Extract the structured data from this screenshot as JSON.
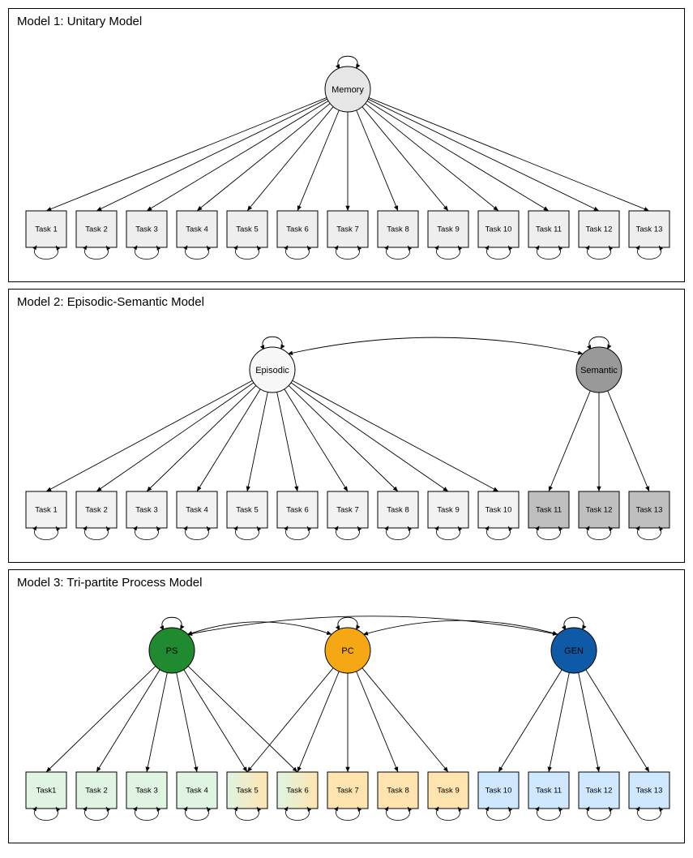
{
  "chart_data": [
    {
      "type": "graph-structure",
      "title": "Model 1: Unitary Model",
      "factors": [
        {
          "name": "Memory",
          "color": "#e6e6e6",
          "tasks": [
            1,
            2,
            3,
            4,
            5,
            6,
            7,
            8,
            9,
            10,
            11,
            12,
            13
          ],
          "self_loop": true
        }
      ],
      "between_factor_paths": [],
      "tasks": [
        {
          "label": "Task 1",
          "fill": "#eeeeee"
        },
        {
          "label": "Task 2",
          "fill": "#eeeeee"
        },
        {
          "label": "Task 3",
          "fill": "#eeeeee"
        },
        {
          "label": "Task 4",
          "fill": "#eeeeee"
        },
        {
          "label": "Task 5",
          "fill": "#eeeeee"
        },
        {
          "label": "Task 6",
          "fill": "#eeeeee"
        },
        {
          "label": "Task 7",
          "fill": "#eeeeee"
        },
        {
          "label": "Task 8",
          "fill": "#eeeeee"
        },
        {
          "label": "Task 9",
          "fill": "#eeeeee"
        },
        {
          "label": "Task 10",
          "fill": "#eeeeee"
        },
        {
          "label": "Task 11",
          "fill": "#eeeeee"
        },
        {
          "label": "Task 12",
          "fill": "#eeeeee"
        },
        {
          "label": "Task 13",
          "fill": "#eeeeee"
        }
      ],
      "task_error_loops": true
    },
    {
      "type": "graph-structure",
      "title": "Model 2: Episodic-Semantic Model",
      "factors": [
        {
          "name": "Episodic",
          "color": "#f7f7f7",
          "tasks": [
            1,
            2,
            3,
            4,
            5,
            6,
            7,
            8,
            9,
            10
          ],
          "self_loop": true
        },
        {
          "name": "Semantic",
          "color": "#999999",
          "tasks": [
            11,
            12,
            13
          ],
          "self_loop": true
        }
      ],
      "between_factor_paths": [
        [
          "Episodic",
          "Semantic"
        ]
      ],
      "tasks": [
        {
          "label": "Task 1",
          "fill": "#f2f2f2"
        },
        {
          "label": "Task 2",
          "fill": "#f2f2f2"
        },
        {
          "label": "Task 3",
          "fill": "#f2f2f2"
        },
        {
          "label": "Task 4",
          "fill": "#f2f2f2"
        },
        {
          "label": "Task 5",
          "fill": "#f2f2f2"
        },
        {
          "label": "Task 6",
          "fill": "#f2f2f2"
        },
        {
          "label": "Task 7",
          "fill": "#f2f2f2"
        },
        {
          "label": "Task 8",
          "fill": "#f2f2f2"
        },
        {
          "label": "Task 9",
          "fill": "#f2f2f2"
        },
        {
          "label": "Task 10",
          "fill": "#f2f2f2"
        },
        {
          "label": "Task 11",
          "fill": "#bfbfbf"
        },
        {
          "label": "Task 12",
          "fill": "#bfbfbf"
        },
        {
          "label": "Task 13",
          "fill": "#bfbfbf"
        }
      ],
      "task_error_loops": true
    },
    {
      "type": "graph-structure",
      "title": "Model 3: Tri-partite Process Model",
      "factors": [
        {
          "name": "PS",
          "color": "#1f8a2f",
          "tasks": [
            1,
            2,
            3,
            4,
            5,
            6
          ],
          "self_loop": true
        },
        {
          "name": "PC",
          "color": "#f5a814",
          "tasks": [
            5,
            6,
            7,
            8,
            9
          ],
          "self_loop": true
        },
        {
          "name": "GEN",
          "color": "#0f5aa6",
          "tasks": [
            10,
            11,
            12,
            13
          ],
          "self_loop": true
        }
      ],
      "between_factor_paths": [
        [
          "PS",
          "PC"
        ],
        [
          "PC",
          "GEN"
        ],
        [
          "PS",
          "GEN"
        ]
      ],
      "tasks": [
        {
          "label": "Task1",
          "fill": "#dff4e1"
        },
        {
          "label": "Task 2",
          "fill": "#dff4e1"
        },
        {
          "label": "Task 3",
          "fill": "#dff4e1"
        },
        {
          "label": "Task 4",
          "fill": "#dff4e1"
        },
        {
          "label": "Task 5",
          "fill": "grad-go"
        },
        {
          "label": "Task 6",
          "fill": "grad-go"
        },
        {
          "label": "Task 7",
          "fill": "#ffe4b0"
        },
        {
          "label": "Task 8",
          "fill": "#ffe4b0"
        },
        {
          "label": "Task 9",
          "fill": "#ffe4b0"
        },
        {
          "label": "Task 10",
          "fill": "#cfe8ff"
        },
        {
          "label": "Task 11",
          "fill": "#cfe8ff"
        },
        {
          "label": "Task 12",
          "fill": "#cfe8ff"
        },
        {
          "label": "Task 13",
          "fill": "#cfe8ff"
        }
      ],
      "task_error_loops": true
    }
  ]
}
